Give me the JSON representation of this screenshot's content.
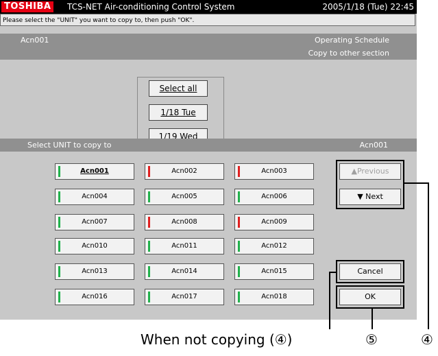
{
  "titlebar": {
    "brand": "TOSHIBA",
    "app_title": "TCS-NET Air-conditioning Control System",
    "datetime": "2005/1/18 (Tue)  22:45"
  },
  "message": "Please select the \"UNIT\" you want to copy to, then push \"OK\".",
  "header": {
    "unit_name": "Acn001",
    "schedule_label": "Operating Schedule",
    "copy_label": "Copy to other section"
  },
  "date_buttons": {
    "select_all": "Select all",
    "day1": "1/18 Tue",
    "day2": "1/19 Wed"
  },
  "panel": {
    "title": "Select UNIT to copy to",
    "current_unit": "Acn001"
  },
  "units": [
    {
      "label": "Acn001",
      "status": "green",
      "selected": true
    },
    {
      "label": "Acn002",
      "status": "red"
    },
    {
      "label": "Acn003",
      "status": "red"
    },
    {
      "label": "Acn004",
      "status": "green"
    },
    {
      "label": "Acn005",
      "status": "green"
    },
    {
      "label": "Acn006",
      "status": "green"
    },
    {
      "label": "Acn007",
      "status": "green"
    },
    {
      "label": "Acn008",
      "status": "red"
    },
    {
      "label": "Acn009",
      "status": "red"
    },
    {
      "label": "Acn010",
      "status": "green"
    },
    {
      "label": "Acn011",
      "status": "green"
    },
    {
      "label": "Acn012",
      "status": "green"
    },
    {
      "label": "Acn013",
      "status": "green"
    },
    {
      "label": "Acn014",
      "status": "green"
    },
    {
      "label": "Acn015",
      "status": "green"
    },
    {
      "label": "Acn016",
      "status": "green"
    },
    {
      "label": "Acn017",
      "status": "green"
    },
    {
      "label": "Acn018",
      "status": "green"
    }
  ],
  "nav": {
    "previous": "▲Previous",
    "next": "▼ Next",
    "cancel": "Cancel",
    "ok": "OK"
  },
  "annotations": {
    "not_copying": "When not copying (④)",
    "five": "⑤",
    "four": "④"
  },
  "colors": {
    "brand_red": "#e60012",
    "status_green": "#22b14c",
    "status_red": "#e02020"
  }
}
